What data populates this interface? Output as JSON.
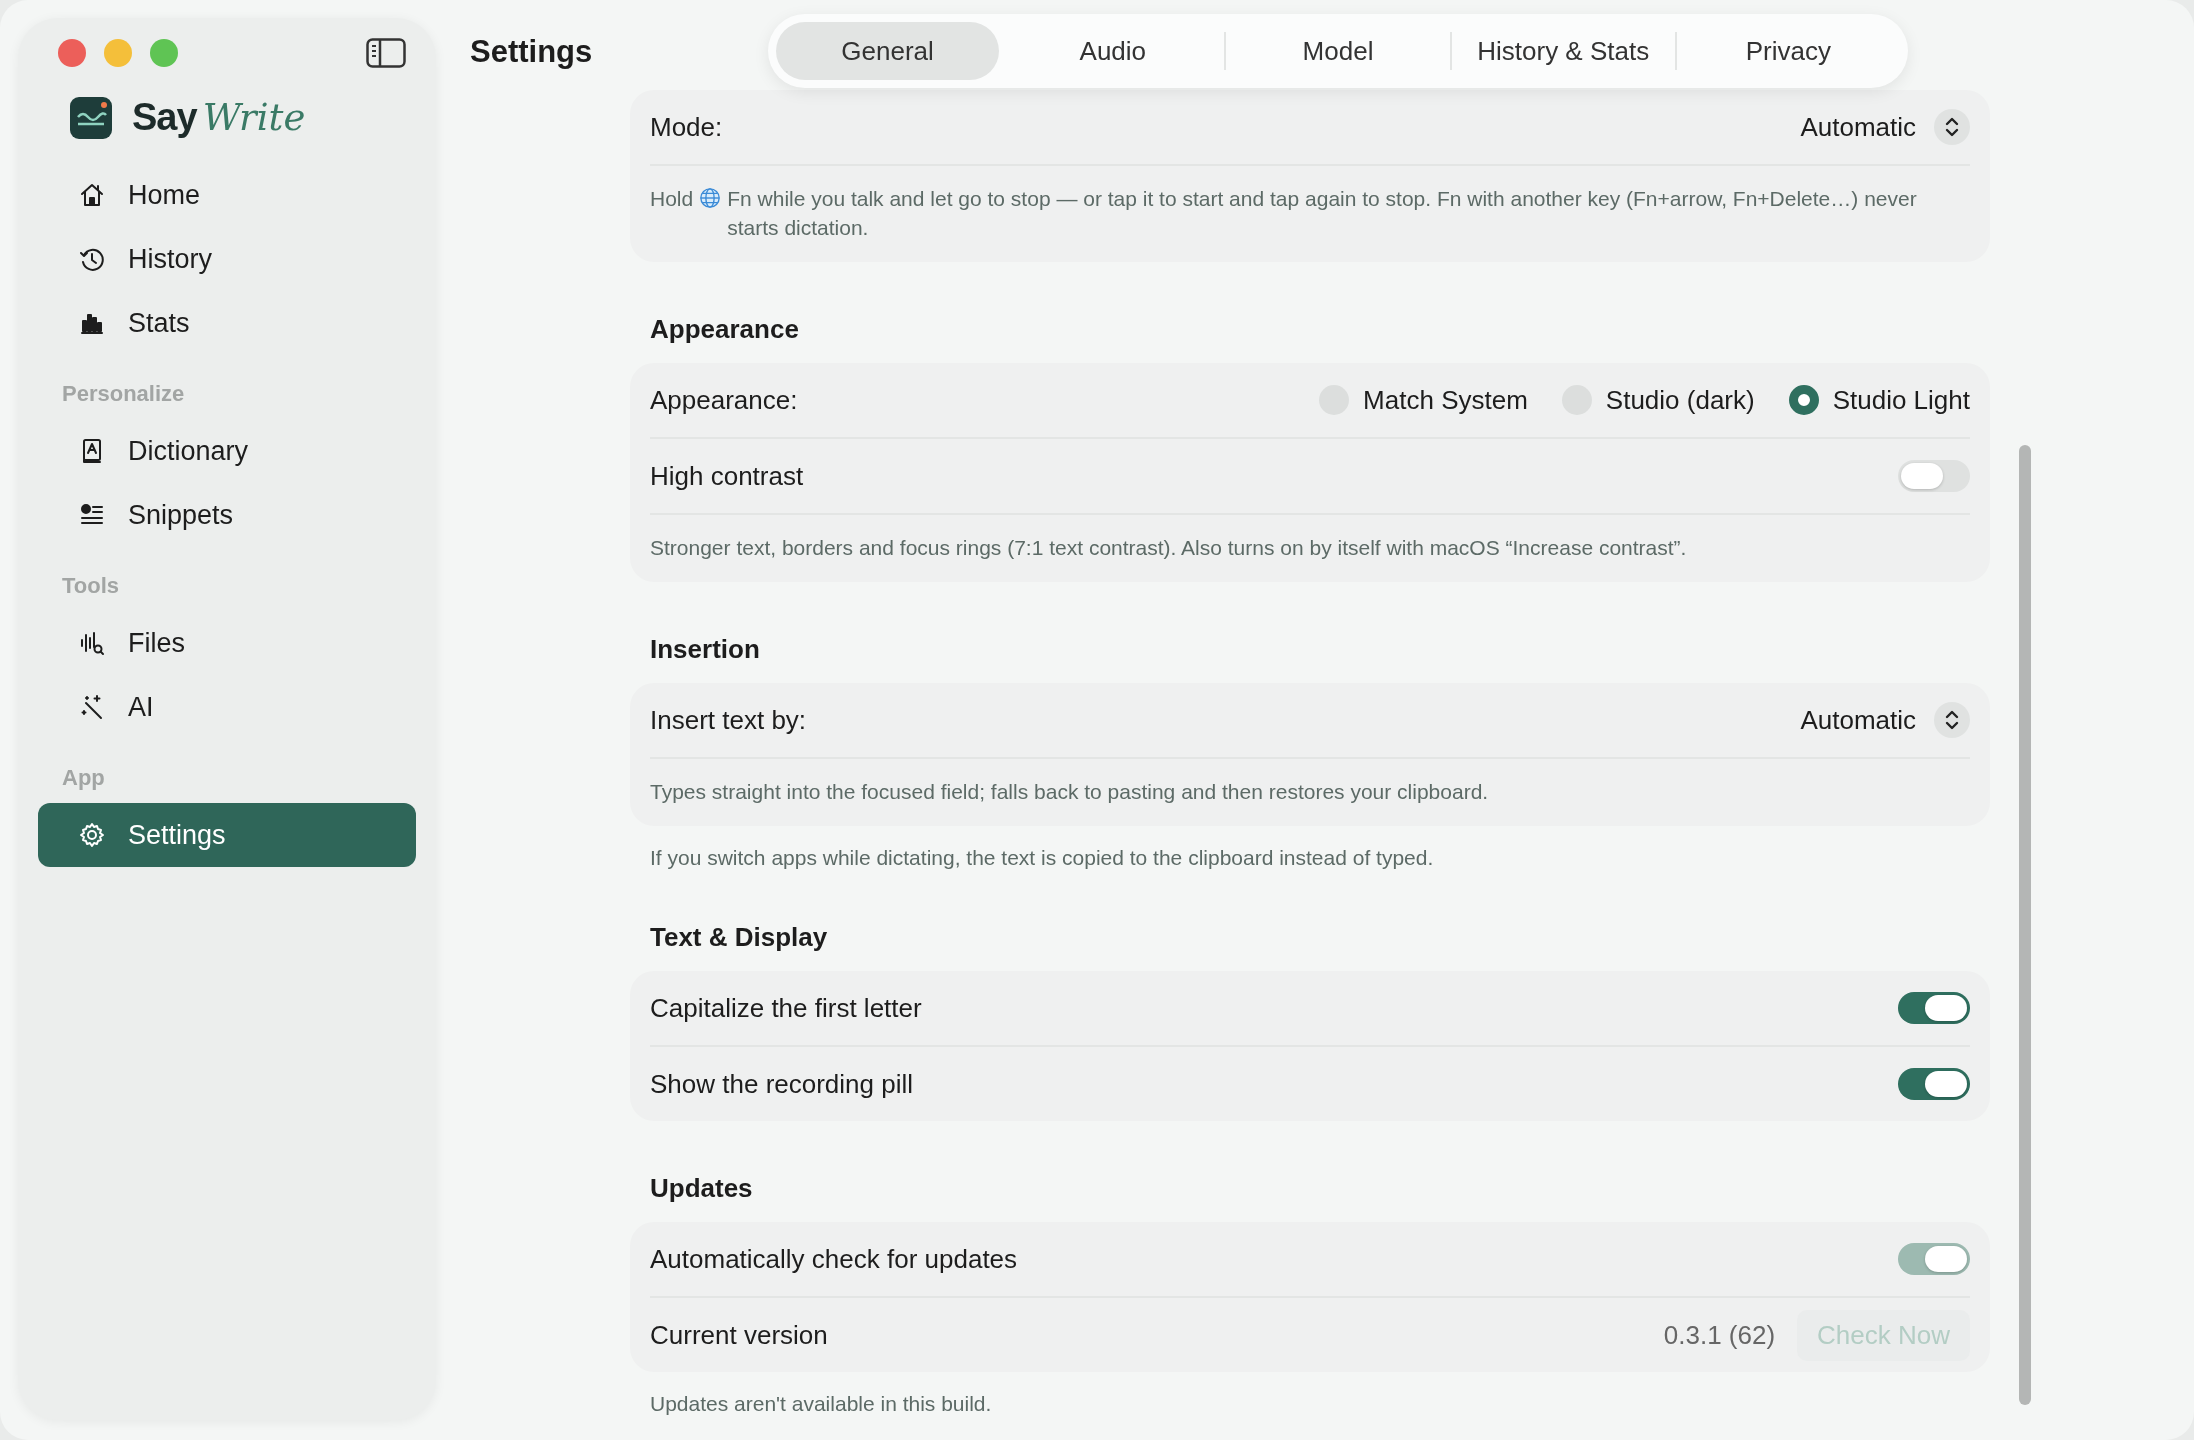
{
  "sidebar": {
    "brand": {
      "name": "Say",
      "name_accent": "Write"
    },
    "groups": [
      {
        "items": [
          {
            "label": "Home",
            "selected": false
          },
          {
            "label": "History",
            "selected": false
          },
          {
            "label": "Stats",
            "selected": false
          }
        ]
      },
      {
        "heading": "Personalize",
        "items": [
          {
            "label": "Dictionary",
            "selected": false
          },
          {
            "label": "Snippets",
            "selected": false
          }
        ]
      },
      {
        "heading": "Tools",
        "items": [
          {
            "label": "Files",
            "selected": false
          },
          {
            "label": "AI",
            "selected": false
          }
        ]
      },
      {
        "heading": "App",
        "items": [
          {
            "label": "Settings",
            "selected": true
          }
        ]
      }
    ]
  },
  "page_title": "Settings",
  "tabs": [
    {
      "label": "General",
      "selected": true
    },
    {
      "label": "Audio",
      "selected": false
    },
    {
      "label": "Model",
      "selected": false
    },
    {
      "label": "History & Stats",
      "selected": false
    },
    {
      "label": "Privacy",
      "selected": false
    }
  ],
  "sections": [
    {
      "rows": [
        {
          "kind": "select",
          "label": "Mode:",
          "value": "Automatic"
        }
      ],
      "hint_lead": "Hold",
      "hint": "Fn while you talk and let go to stop — or tap it to start and tap again to stop. Fn with another key (Fn+arrow, Fn+Delete…) never starts dictation."
    },
    {
      "heading": "Appearance",
      "rows": [
        {
          "kind": "radio",
          "label": "Appearance:",
          "options": [
            {
              "label": "Match System",
              "selected": false
            },
            {
              "label": "Studio (dark)",
              "selected": false
            },
            {
              "label": "Studio Light",
              "selected": true
            }
          ]
        },
        {
          "kind": "toggle",
          "label": "High contrast",
          "on": false,
          "disabled": false
        }
      ],
      "hint": "Stronger text, borders and focus rings (7:1 text contrast). Also turns on by itself with macOS “Increase contrast”."
    },
    {
      "heading": "Insertion",
      "rows": [
        {
          "kind": "select",
          "label": "Insert text by:",
          "value": "Automatic"
        }
      ],
      "hint": "Types straight into the focused field; falls back to pasting and then restores your clipboard.",
      "note": "If you switch apps while dictating, the text is copied to the clipboard instead of typed."
    },
    {
      "heading": "Text & Display",
      "rows": [
        {
          "kind": "toggle",
          "label": "Capitalize the first letter",
          "on": true,
          "disabled": false
        },
        {
          "kind": "toggle",
          "label": "Show the recording pill",
          "on": true,
          "disabled": false
        }
      ]
    },
    {
      "heading": "Updates",
      "rows": [
        {
          "kind": "toggle",
          "label": "Automatically check for updates",
          "on": true,
          "disabled": true
        },
        {
          "kind": "version",
          "label": "Current version",
          "value": "0.3.1 (62)",
          "button": "Check Now",
          "button_disabled": true
        }
      ],
      "note": "Updates aren't available in this build."
    }
  ]
}
